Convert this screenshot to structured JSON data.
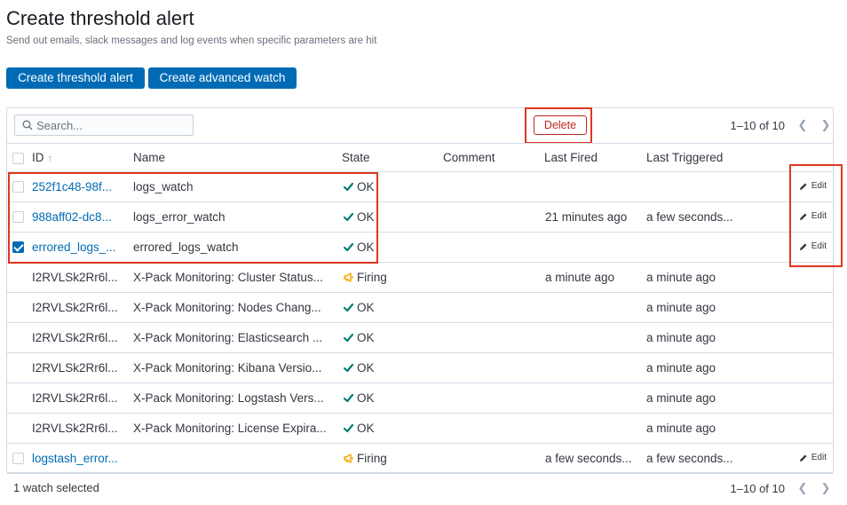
{
  "header": {
    "title": "Create threshold alert",
    "subtitle": "Send out emails, slack messages and log events when specific parameters are hit"
  },
  "actions": {
    "threshold_label": "Create threshold alert",
    "advanced_label": "Create advanced watch",
    "delete_label": "Delete"
  },
  "search": {
    "placeholder": "Search..."
  },
  "pagination": {
    "range": "1–10 of 10"
  },
  "columns": {
    "id": "ID",
    "sort_indicator": "↑",
    "name": "Name",
    "state": "State",
    "comment": "Comment",
    "last_fired": "Last Fired",
    "last_triggered": "Last Triggered"
  },
  "edit_label": "Edit",
  "rows": [
    {
      "id": "252f1c48-98f...",
      "name": "logs_watch",
      "state": "OK",
      "last_fired": "",
      "last_triggered": "",
      "selectable": true,
      "checked": false,
      "editable": true
    },
    {
      "id": "988aff02-dc8...",
      "name": "logs_error_watch",
      "state": "OK",
      "last_fired": "21 minutes ago",
      "last_triggered": "a few seconds...",
      "selectable": true,
      "checked": false,
      "editable": true
    },
    {
      "id": "errored_logs_...",
      "name": "errored_logs_watch",
      "state": "OK",
      "last_fired": "",
      "last_triggered": "",
      "selectable": true,
      "checked": true,
      "editable": true
    },
    {
      "id": "I2RVLSk2Rr6l...",
      "name": "X-Pack Monitoring: Cluster Status...",
      "state": "Firing",
      "last_fired": "a minute ago",
      "last_triggered": "a minute ago",
      "selectable": false,
      "checked": false,
      "editable": false
    },
    {
      "id": "I2RVLSk2Rr6l...",
      "name": "X-Pack Monitoring: Nodes Chang...",
      "state": "OK",
      "last_fired": "",
      "last_triggered": "a minute ago",
      "selectable": false,
      "checked": false,
      "editable": false
    },
    {
      "id": "I2RVLSk2Rr6l...",
      "name": "X-Pack Monitoring: Elasticsearch ...",
      "state": "OK",
      "last_fired": "",
      "last_triggered": "a minute ago",
      "selectable": false,
      "checked": false,
      "editable": false
    },
    {
      "id": "I2RVLSk2Rr6l...",
      "name": "X-Pack Monitoring: Kibana Versio...",
      "state": "OK",
      "last_fired": "",
      "last_triggered": "a minute ago",
      "selectable": false,
      "checked": false,
      "editable": false
    },
    {
      "id": "I2RVLSk2Rr6l...",
      "name": "X-Pack Monitoring: Logstash Vers...",
      "state": "OK",
      "last_fired": "",
      "last_triggered": "a minute ago",
      "selectable": false,
      "checked": false,
      "editable": false
    },
    {
      "id": "I2RVLSk2Rr6l...",
      "name": "X-Pack Monitoring: License Expira...",
      "state": "OK",
      "last_fired": "",
      "last_triggered": "a minute ago",
      "selectable": false,
      "checked": false,
      "editable": false
    },
    {
      "id": "logstash_error...",
      "name": "",
      "state": "Firing",
      "last_fired": "a few seconds...",
      "last_triggered": "a few seconds...",
      "selectable": true,
      "checked": false,
      "editable": true
    }
  ],
  "footer": {
    "selected_text": "1 watch selected"
  },
  "colors": {
    "primary": "#006bb4",
    "danger": "#bd271e",
    "ok_green": "#017d73",
    "firing_orange": "#f5a700",
    "highlight_red": "#e0361f"
  },
  "icons": {
    "ok": "check-icon",
    "firing": "megaphone-icon",
    "edit": "pencil-icon",
    "search": "search-icon",
    "prev": "chevron-left-icon",
    "next": "chevron-right-icon"
  }
}
